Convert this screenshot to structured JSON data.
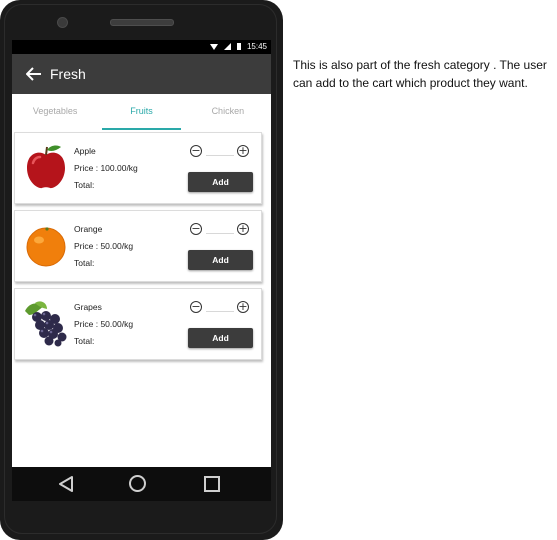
{
  "status_bar": {
    "time": "15:45"
  },
  "app_bar": {
    "title": "Fresh"
  },
  "tabs": [
    {
      "label": "Vegetables",
      "active": false
    },
    {
      "label": "Fruits",
      "active": true
    },
    {
      "label": "Chicken",
      "active": false
    }
  ],
  "products": [
    {
      "name": "Apple",
      "price": "Price : 100.00/kg",
      "total": "Total:",
      "add_label": "Add",
      "quantity": "",
      "image": "apple"
    },
    {
      "name": "Orange",
      "price": "Price : 50.00/kg",
      "total": "Total:",
      "add_label": "Add",
      "quantity": "",
      "image": "orange"
    },
    {
      "name": "Grapes",
      "price": "Price : 50.00/kg",
      "total": "Total:",
      "add_label": "Add",
      "quantity": "",
      "image": "grapes"
    }
  ],
  "icons": {
    "back": "arrow-left-icon",
    "minus": "minus-circle-icon",
    "plus": "plus-circle-icon",
    "nav_back": "triangle-back-icon",
    "nav_home": "circle-home-icon",
    "nav_recents": "square-recents-icon"
  },
  "colors": {
    "app_bar": "#3c3c3c",
    "accent": "#2aa9a9",
    "add_button": "#3c3c3c"
  },
  "description": "This is also part of the fresh category . The user can add to the cart which product they want."
}
